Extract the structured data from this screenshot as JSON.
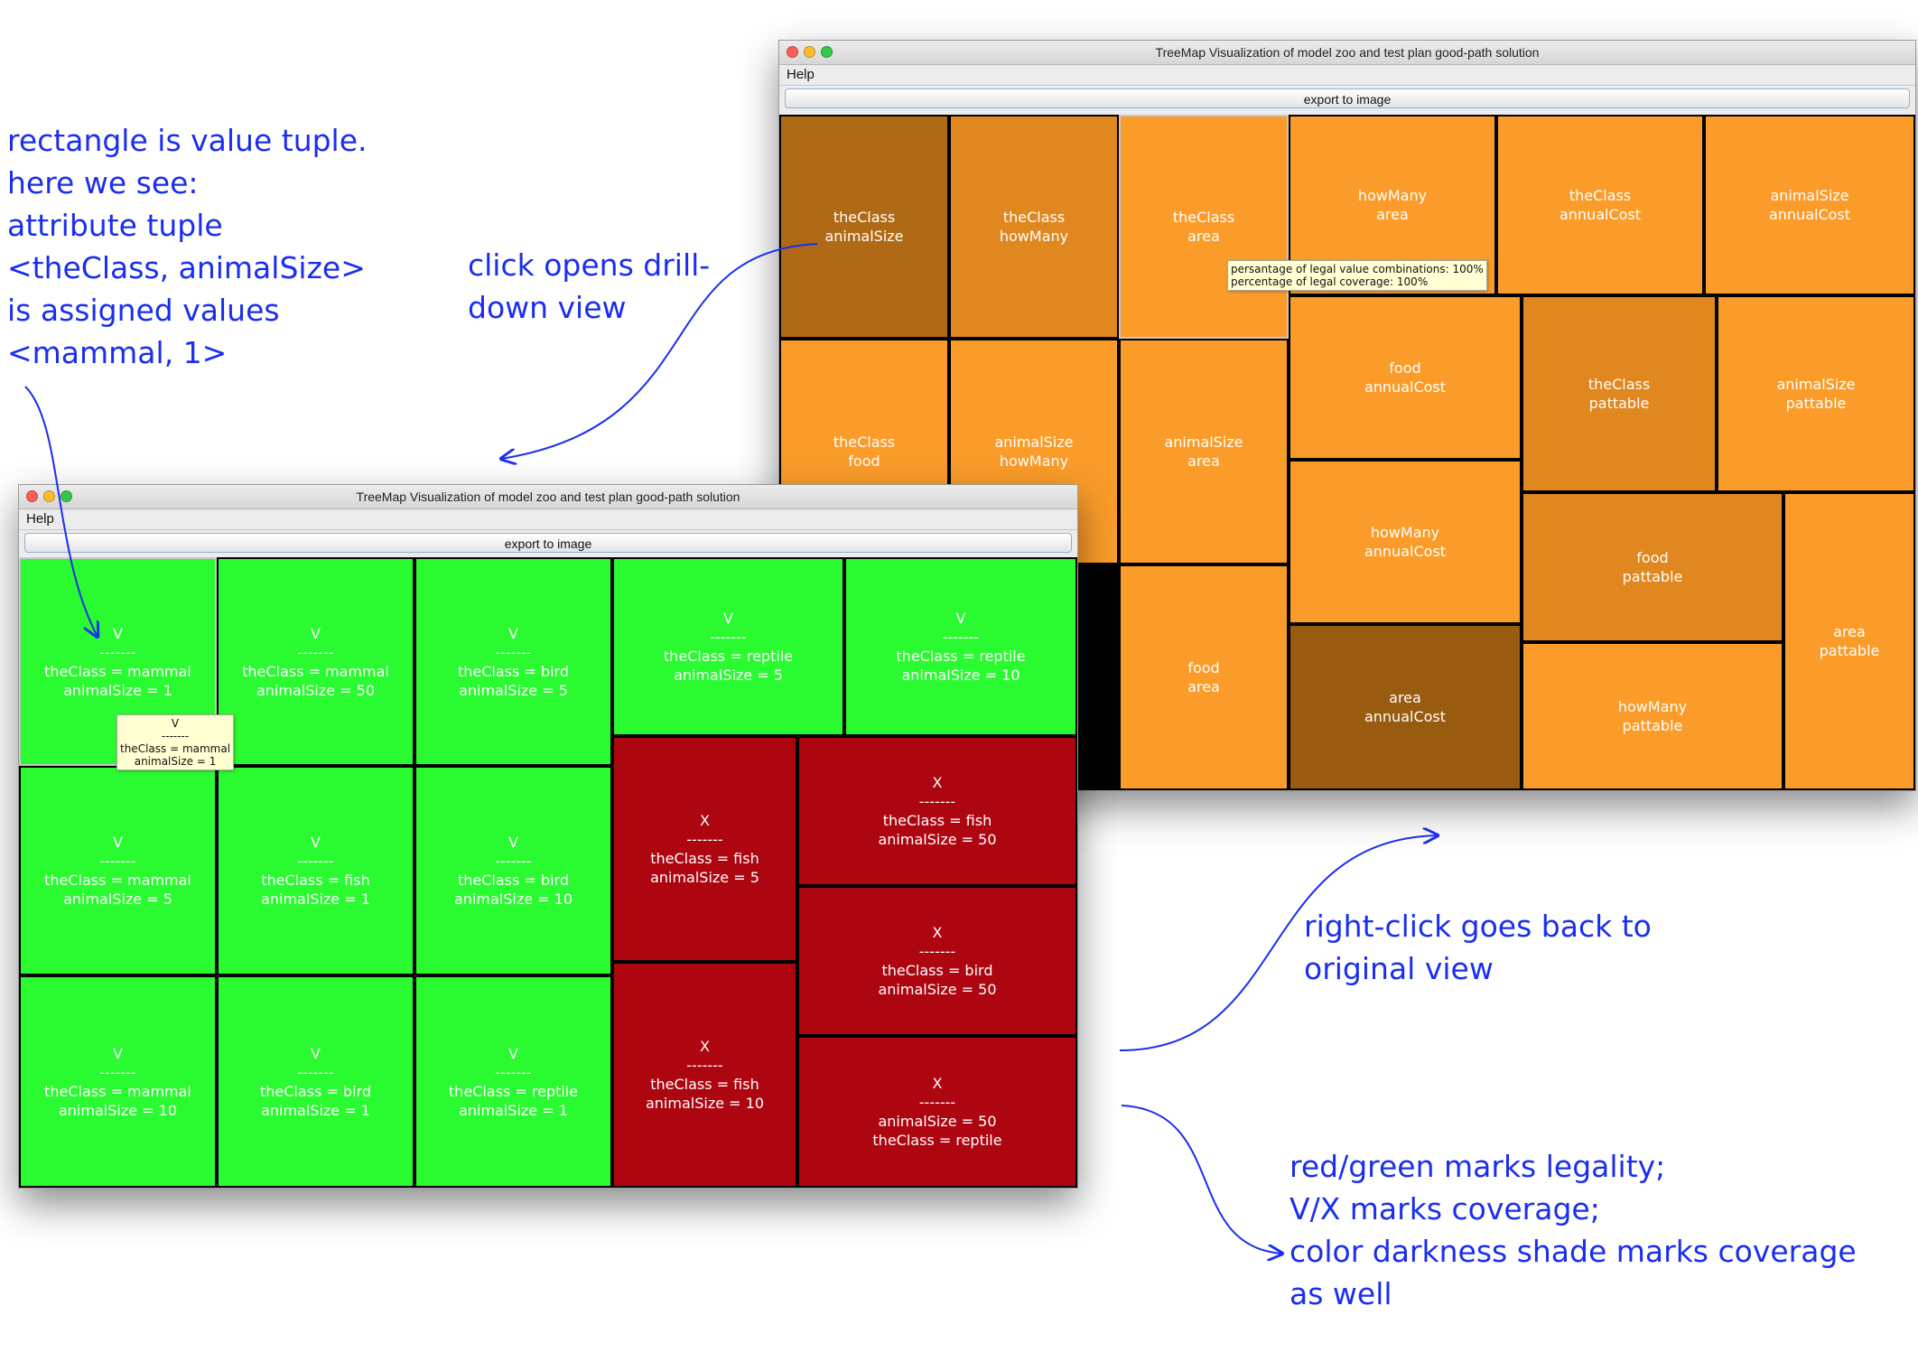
{
  "colors": {
    "green": "#2afb30",
    "red": "#ad0611",
    "orange_light": "#fb9c2a",
    "orange_mid": "#e0871f",
    "orange_dark": "#b06a16",
    "orange_darkest": "#985b10",
    "annotation_blue": "#1a2ef0"
  },
  "window_top": {
    "title": "TreeMap Visualization of model zoo and test plan good-path solution",
    "menu_help": "Help",
    "export_label": "export to image",
    "tooltip": "persantage of legal value combinations: 100%\npercentage of legal coverage: 100%",
    "cells": [
      {
        "label": "theClass\nanimalSize",
        "shade": "orange_dark"
      },
      {
        "label": "theClass\nhowMany",
        "shade": "orange_mid"
      },
      {
        "label": "theClass\narea",
        "shade": "orange_light",
        "selected": true
      },
      {
        "label": "howMany\narea",
        "shade": "orange_light"
      },
      {
        "label": "theClass\nannualCost",
        "shade": "orange_light"
      },
      {
        "label": "animalSize\nannualCost",
        "shade": "orange_light"
      },
      {
        "label": "theClass\nfood",
        "shade": "orange_light"
      },
      {
        "label": "animalSize\nhowMany",
        "shade": "orange_light"
      },
      {
        "label": "animalSize\narea",
        "shade": "orange_light"
      },
      {
        "label": "food\nannualCost",
        "shade": "orange_light"
      },
      {
        "label": "theClass\npattable",
        "shade": "orange_mid"
      },
      {
        "label": "animalSize\npattable",
        "shade": "orange_light"
      },
      {
        "label": "food\narea",
        "shade": "orange_light"
      },
      {
        "label": "howMany\nannualCost",
        "shade": "orange_light"
      },
      {
        "label": "food\npattable",
        "shade": "orange_mid"
      },
      {
        "label": "area\npattable",
        "shade": "orange_light"
      },
      {
        "label": "area\nannualCost",
        "shade": "orange_darkest"
      },
      {
        "label": "howMany\npattable",
        "shade": "orange_light"
      }
    ]
  },
  "window_bottom": {
    "title": "TreeMap Visualization of model zoo and test plan good-path solution",
    "menu_help": "Help",
    "export_label": "export to image",
    "tooltip": "V\n-------\ntheClass = mammal\nanimalSize = 1",
    "cells": [
      {
        "label": "V\n-------\ntheClass = mammal\nanimalSize = 1",
        "legal": true,
        "selected": true
      },
      {
        "label": "V\n-------\ntheClass = mammal\nanimalSize = 50",
        "legal": true
      },
      {
        "label": "V\n-------\ntheClass = bird\nanimalSize = 5",
        "legal": true
      },
      {
        "label": "V\n-------\ntheClass = reptile\nanimalSize = 5",
        "legal": true
      },
      {
        "label": "V\n-------\ntheClass = reptile\nanimalSize = 10",
        "legal": true
      },
      {
        "label": "V\n-------\ntheClass = mammal\nanimalSize = 5",
        "legal": true
      },
      {
        "label": "V\n-------\ntheClass = fish\nanimalSize = 1",
        "legal": true
      },
      {
        "label": "V\n-------\ntheClass = bird\nanimalSize = 10",
        "legal": true
      },
      {
        "label": "X\n-------\ntheClass = fish\nanimalSize = 5",
        "legal": false
      },
      {
        "label": "X\n-------\ntheClass = fish\nanimalSize = 50",
        "legal": false
      },
      {
        "label": "X\n-------\ntheClass = bird\nanimalSize = 50",
        "legal": false
      },
      {
        "label": "V\n-------\ntheClass = mammal\nanimalSize = 10",
        "legal": true
      },
      {
        "label": "V\n-------\ntheClass = bird\nanimalSize = 1",
        "legal": true
      },
      {
        "label": "V\n-------\ntheClass = reptile\nanimalSize = 1",
        "legal": true
      },
      {
        "label": "X\n-------\ntheClass = fish\nanimalSize = 10",
        "legal": false
      },
      {
        "label": "X\n-------\nanimalSize = 50\ntheClass = reptile",
        "legal": false
      }
    ]
  },
  "annotations": {
    "rectangle_note": "rectangle is value tuple.\nhere we see:\nattribute tuple\n<theClass, animalSize>\nis assigned values\n<mammal, 1>",
    "click_note": "click opens drill-\ndown view",
    "right_click_note": "right-click goes back to\noriginal view",
    "legend_note": "red/green marks legality;\nV/X marks coverage;\ncolor darkness shade marks coverage\nas well"
  }
}
